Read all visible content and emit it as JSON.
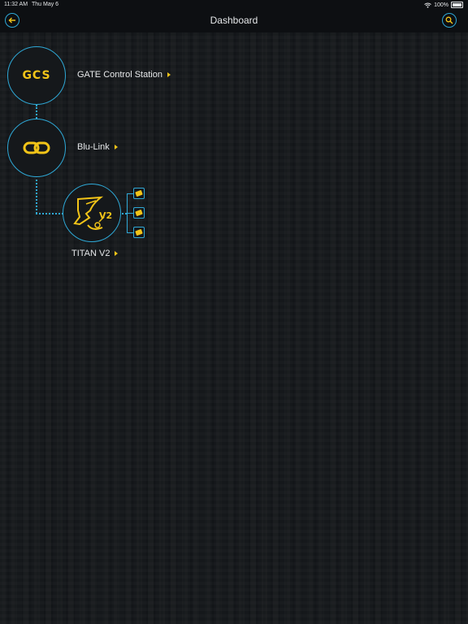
{
  "status": {
    "time": "11:32 AM",
    "date": "Thu May 6",
    "battery": "100%"
  },
  "header": {
    "title": "Dashboard"
  },
  "nodes": {
    "gcs": {
      "label": "GATE Control Station",
      "logo_text": "GCS"
    },
    "blulink": {
      "label": "Blu-Link"
    },
    "titan": {
      "label": "TITAN V2",
      "logo_text": "V2"
    }
  },
  "colors": {
    "accent": "#2ea8d6",
    "brand": "#f2c418",
    "background": "#15181b"
  }
}
